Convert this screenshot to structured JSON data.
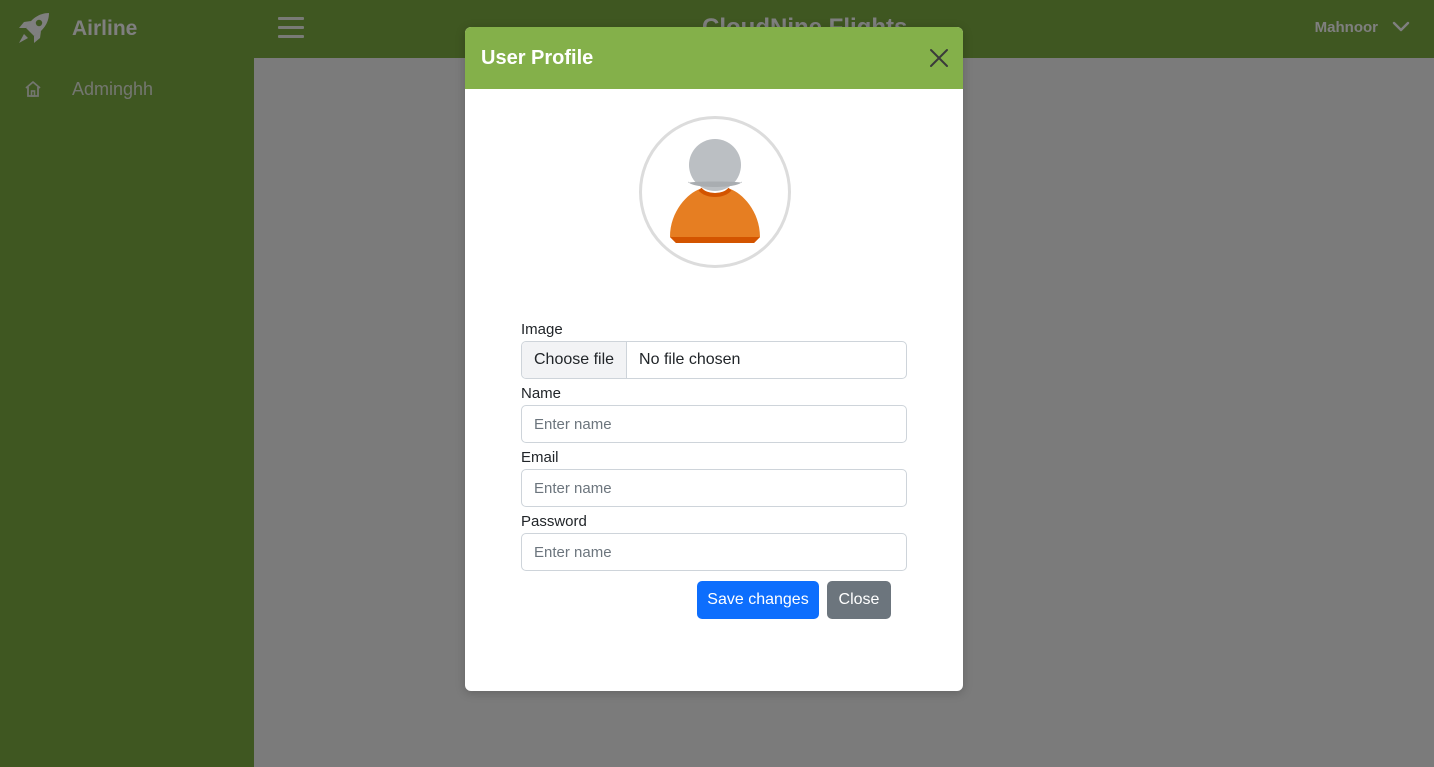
{
  "sidebar": {
    "brand": "Airline",
    "brand_icon": "rocket-icon",
    "items": [
      {
        "label": "Adminghh",
        "icon": "home-icon"
      }
    ]
  },
  "header": {
    "title": "CloudNine Flights",
    "user_name": "Mahnoor",
    "menu_icon": "hamburger-icon",
    "dropdown_icon": "chevron-down-icon"
  },
  "modal": {
    "title": "User Profile",
    "close_icon": "close-icon",
    "avatar_icon": "user-avatar-icon",
    "fields": {
      "image": {
        "label": "Image",
        "button": "Choose file",
        "status": "No file chosen"
      },
      "name": {
        "label": "Name",
        "placeholder": "Enter name",
        "value": ""
      },
      "email": {
        "label": "Email",
        "placeholder": "Enter name",
        "value": ""
      },
      "password": {
        "label": "Password",
        "placeholder": "Enter name",
        "value": ""
      }
    },
    "buttons": {
      "save": "Save changes",
      "close": "Close"
    }
  },
  "colors": {
    "brand_green": "#7fae43",
    "modal_header": "#84b04a",
    "primary": "#0d6efd",
    "secondary": "#6c757d"
  }
}
